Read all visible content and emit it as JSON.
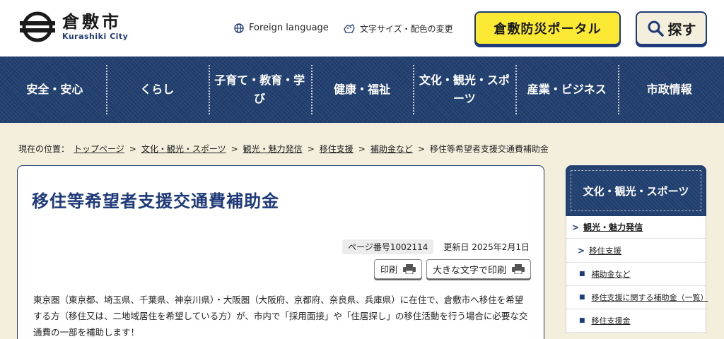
{
  "header": {
    "logo_jp": "倉敷市",
    "logo_en": "Kurashiki City",
    "foreign_language": "Foreign language",
    "text_size_color": "文字サイズ・配色の変更",
    "disaster_portal": "倉敷防災ポータル",
    "search": "探す"
  },
  "nav": {
    "items": [
      {
        "label": "安全・安心"
      },
      {
        "label": "くらし"
      },
      {
        "label": "子育て・教育・学び"
      },
      {
        "label": "健康・福祉"
      },
      {
        "label": "文化・観光・スポーツ"
      },
      {
        "label": "産業・ビジネス"
      },
      {
        "label": "市政情報"
      }
    ]
  },
  "breadcrumb": {
    "prefix": "現在の位置：",
    "links": [
      "トップページ",
      "文化・観光・スポーツ",
      "観光・魅力発信",
      "移住支援",
      "補助金など"
    ],
    "separator": ">",
    "current": "移住等希望者支援交通費補助金"
  },
  "main": {
    "title": "移住等希望者支援交通費補助金",
    "page_number": "ページ番号1002114",
    "updated": "更新日 2025年2月1日",
    "print_label": "印刷",
    "print_large_label": "大きな文字で印刷",
    "body": "東京圏（東京都、埼玉県、千葉県、神奈川県）・大阪圏（大阪府、京都府、奈良県、兵庫県）に在住で、倉敷市へ移住を希望する方（移住又は、二地域居住を希望している方）が、市内で「採用面接」や「住居探し」の移住活動を行う場合に必要な交通費の一部を補助します！"
  },
  "sidebar": {
    "heading": "文化・観光・スポーツ",
    "items": [
      {
        "label": "観光・魅力発信",
        "marker": ">"
      },
      {
        "label": "移住支援",
        "marker": ">"
      },
      {
        "label": "補助金など",
        "marker": "■"
      },
      {
        "label": "移住支援に関する補助金（一覧）",
        "marker": "■"
      },
      {
        "label": "移住支援金",
        "marker": "■"
      }
    ]
  },
  "colors": {
    "navy": "#21406f",
    "accent_text": "#1f3a78",
    "portal_yellow": "#fbe934",
    "page_bg": "#f4efdc"
  },
  "icons": {
    "logo": "kurashiki-city-logo",
    "globe": "globe-icon",
    "text_size": "text-size-icon",
    "search": "magnifier-icon",
    "print": "printer-icon"
  }
}
